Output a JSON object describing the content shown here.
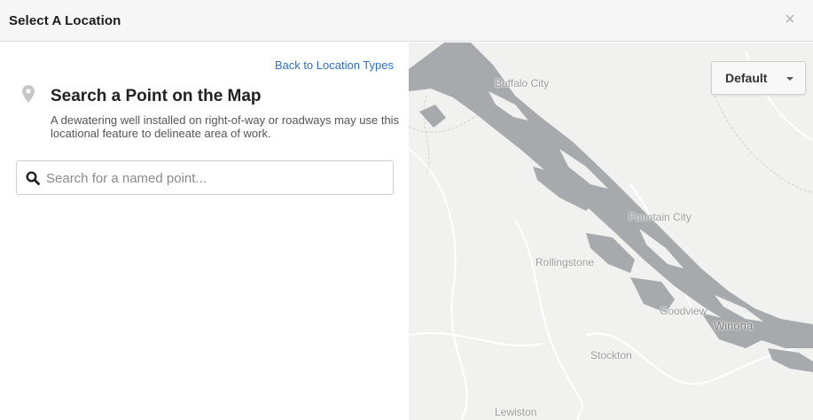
{
  "header": {
    "title": "Select A Location",
    "close_glyph": "×",
    "close_icon": "close-icon"
  },
  "panel": {
    "back_link": "Back to Location Types",
    "pin_icon": "map-pin-icon",
    "title": "Search a Point on the Map",
    "description": "A dewatering well installed on right-of-way or roadways may use this locational feature to delineate area of work.",
    "search": {
      "icon": "search-icon",
      "placeholder": "Search for a named point...",
      "value": ""
    }
  },
  "map": {
    "style_selector": {
      "label": "Default",
      "icon": "caret-down-icon"
    },
    "places": {
      "buffalo_city": "Buffalo City",
      "fountain_city": "Fountain City",
      "rollingstone": "Rollingstone",
      "goodview": "Goodview",
      "winona": "Winona",
      "stockton": "Stockton",
      "lewiston": "Lewiston"
    },
    "colors": {
      "land": "#f1f1f0",
      "water": "#a6aaad",
      "roads": "#ffffff",
      "boundaries": "#c8c8c8"
    }
  }
}
